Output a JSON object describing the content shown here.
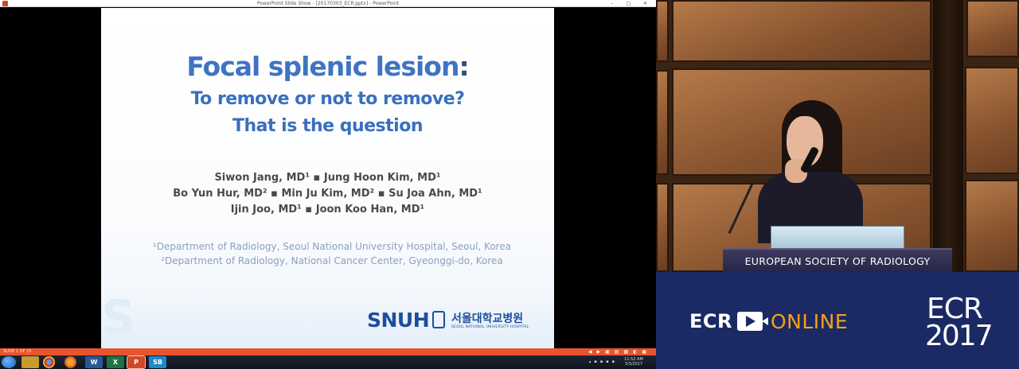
{
  "powerpoint": {
    "window_title": "PowerPoint Slide Show - [20170303_ECR.pptx] - PowerPoint",
    "window_controls": "–  □  ✕",
    "slide_counter": "SLIDE 1 OF 15",
    "slide": {
      "title": "Focal splenic lesion",
      "title_colon": ":",
      "subtitle_line1": "To remove or not to remove?",
      "subtitle_line2": "That is the question",
      "authors_line1": "Siwon Jang, MD¹ ▪ Jung Hoon Kim, MD¹",
      "authors_line2": "Bo Yun Hur, MD² ▪ Min Ju Kim, MD² ▪ Su Joa Ahn, MD¹",
      "authors_line3": "Ijin Joo, MD¹ ▪ Joon Koo Han, MD¹",
      "affiliation1": "¹Department of Radiology,  Seoul National University Hospital, Seoul, Korea",
      "affiliation2": "²Department of Radiology, National Cancer Center, Gyeonggi-do, Korea",
      "logo_text": "SNUH",
      "logo_korean": "서울대학교병원",
      "logo_english": "SEOUL NATIONAL UNIVERSITY HOSPITAL"
    },
    "accent_color": "#e8542e"
  },
  "taskbar": {
    "word_label": "W",
    "excel_label": "X",
    "ppt_label": "P",
    "sb_label": "SB",
    "clock_time": "11:52 AM",
    "clock_date": "3/3/2017"
  },
  "video": {
    "lectern_label": "EUROPEAN SOCIETY OF RADIOLOGY"
  },
  "branding": {
    "ecr_text": "ECR",
    "online_text": "ONLINE",
    "event_name": "ECR",
    "event_year": "2017",
    "banner_color": "#1b2a64",
    "online_color": "#f4a11a"
  }
}
